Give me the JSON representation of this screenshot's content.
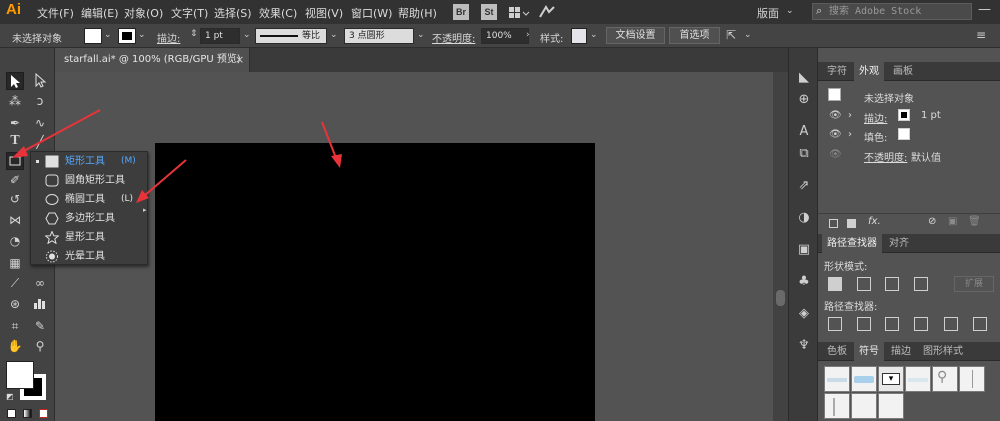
{
  "app": {
    "logo": "Ai"
  },
  "menu": [
    "文件(F)",
    "编辑(E)",
    "对象(O)",
    "文字(T)",
    "选择(S)",
    "效果(C)",
    "视图(V)",
    "窗口(W)",
    "帮助(H)"
  ],
  "menubar": {
    "bridge_label": "Br",
    "stock_label": "St",
    "workspace_label": "版面",
    "search_placeholder": "搜索 Adobe Stock",
    "win_min": "—",
    "win_max": "▢",
    "win_close": "✕"
  },
  "control": {
    "no_selection": "未选择对象",
    "stroke_label": "描边:",
    "stroke_value": "1 pt",
    "stroke_profile": "等比",
    "brush_label": "3 点圆形",
    "opacity_label": "不透明度:",
    "opacity_value": "100%",
    "style_label": "样式:",
    "doc_setup_button": "文档设置",
    "preferences_button": "首选项"
  },
  "document": {
    "tab_title": "starfall.ai* @ 100% (RGB/GPU 预览)",
    "close_glyph": "×"
  },
  "tool_flyout": {
    "items": [
      {
        "label": "矩形工具",
        "shortcut": "(M)",
        "icon": "rectangle-icon",
        "glyph": "□",
        "active": true
      },
      {
        "label": "圆角矩形工具",
        "shortcut": "",
        "icon": "rounded-rectangle-icon",
        "glyph": "▢",
        "active": false
      },
      {
        "label": "椭圆工具",
        "shortcut": "(L)",
        "icon": "ellipse-icon",
        "glyph": "⬭",
        "active": false
      },
      {
        "label": "多边形工具",
        "shortcut": "",
        "icon": "polygon-icon",
        "glyph": "⬡",
        "active": false
      },
      {
        "label": "星形工具",
        "shortcut": "",
        "icon": "star-icon",
        "glyph": "☆",
        "active": false
      },
      {
        "label": "光晕工具",
        "shortcut": "",
        "icon": "flare-icon",
        "glyph": "✺",
        "active": false
      }
    ]
  },
  "appearance_panel": {
    "tabs": [
      "字符",
      "外观",
      "画板"
    ],
    "active_tab": 1,
    "title": "未选择对象",
    "stroke_label": "描边:",
    "stroke_value": "1 pt",
    "fill_label": "填色:",
    "opacity_label": "不透明度:",
    "opacity_value": "默认值",
    "fx_label": "fx."
  },
  "pathfinder_panel": {
    "tabs": [
      "路径查找器",
      "对齐"
    ],
    "active_tab": 0,
    "shape_modes_label": "形状模式:",
    "expand_button": "扩展",
    "pathfinders_label": "路径查找器:"
  },
  "symbols_panel": {
    "tabs": [
      "色板",
      "符号",
      "描边",
      "图形样式"
    ],
    "active_tab": 1
  },
  "colors": {
    "menubar_bg": "#323232",
    "control_bg": "#444444",
    "pasteboard": "#535353",
    "artboard": "#000000",
    "active_tool_text": "#56a9ff",
    "annotation_arrow": "#e8333a",
    "logo": "#ff9a00"
  }
}
